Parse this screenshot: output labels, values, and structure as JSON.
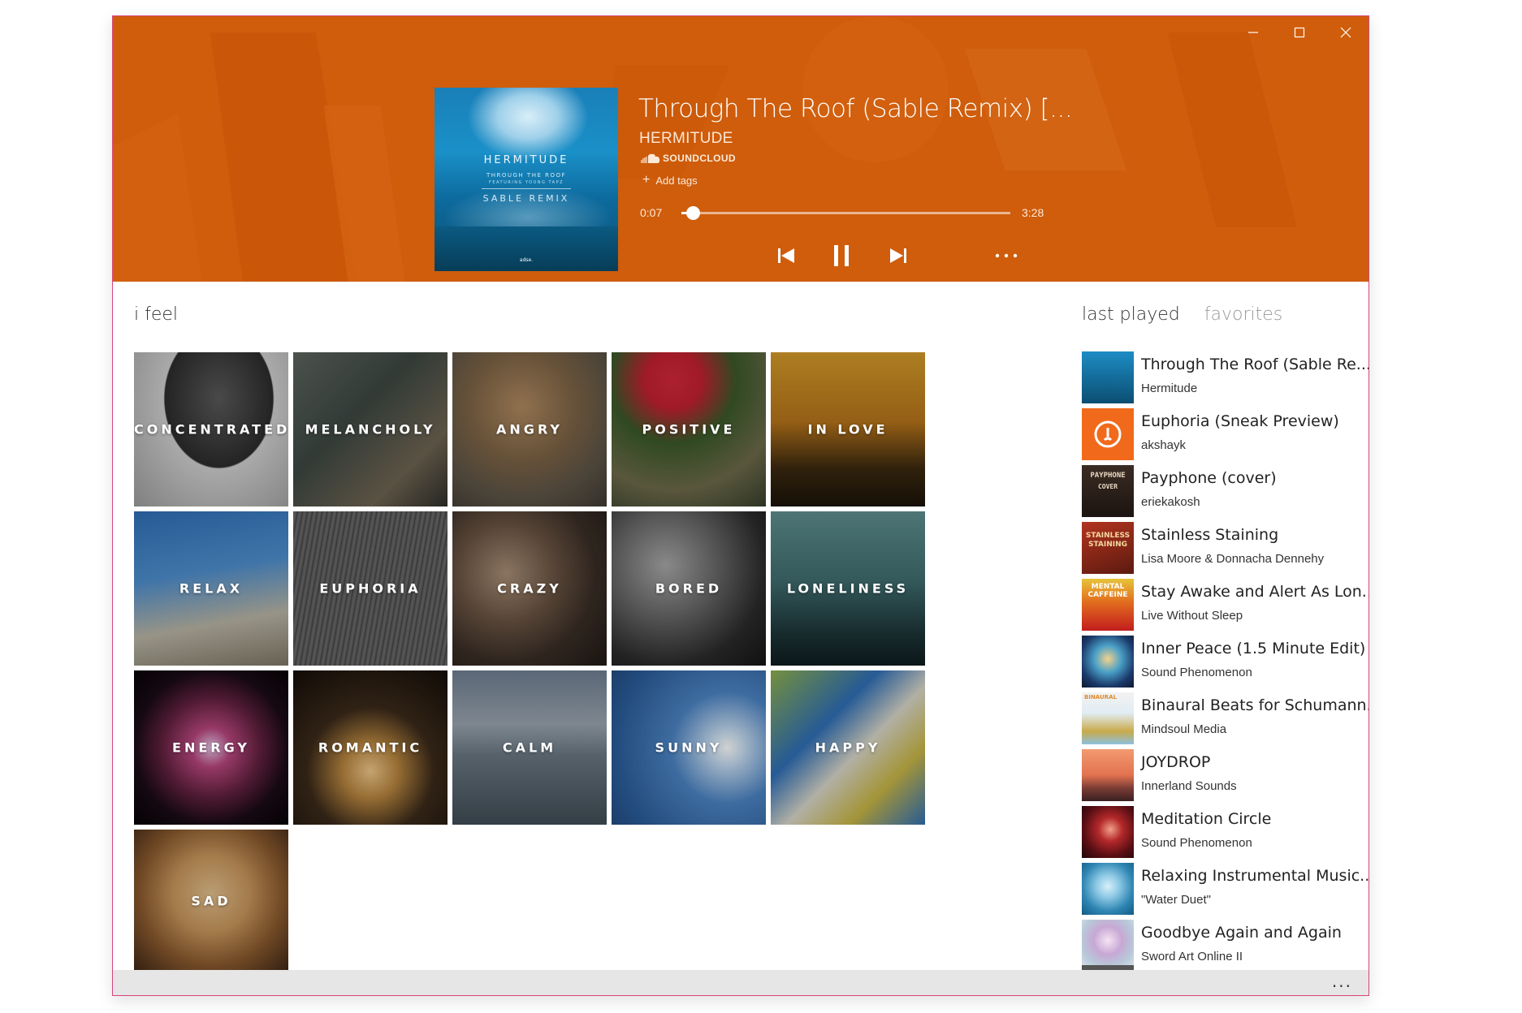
{
  "window": {
    "controls": [
      "minimize",
      "maximize",
      "close"
    ]
  },
  "now_playing": {
    "title": "Through The Roof (Sable Remix) [...",
    "artist": "HERMITUDE",
    "source": "SOUNDCLOUD",
    "add_tags_label": "Add tags",
    "time_current": "0:07",
    "time_total": "3:28",
    "progress_fraction": 0.034,
    "cover": {
      "line1": "HERMITUDE",
      "line2": "THROUGH THE ROOF",
      "line3": "FEATURING YOUNG TAPZ",
      "line4": "SABLE REMIX",
      "label": "adse."
    },
    "accent_color": "#cf5d0c"
  },
  "mood_section": {
    "title": "i feel",
    "tiles": [
      {
        "label": "CONCENTRATED"
      },
      {
        "label": "MELANCHOLY"
      },
      {
        "label": "ANGRY"
      },
      {
        "label": "POSITIVE"
      },
      {
        "label": "IN LOVE"
      },
      {
        "label": "RELAX"
      },
      {
        "label": "EUPHORIA"
      },
      {
        "label": "CRAZY"
      },
      {
        "label": "BORED"
      },
      {
        "label": "LONELINESS"
      },
      {
        "label": "ENERGY"
      },
      {
        "label": "ROMANTIC"
      },
      {
        "label": "CALM"
      },
      {
        "label": "SUNNY"
      },
      {
        "label": "HAPPY"
      },
      {
        "label": "SAD"
      }
    ]
  },
  "sidebar": {
    "tabs": [
      {
        "label": "last played"
      },
      {
        "label": "favorites"
      }
    ],
    "items": [
      {
        "title": "Through The Roof (Sable Re...",
        "artist": "Hermitude"
      },
      {
        "title": "Euphoria (Sneak Preview)",
        "artist": "akshayk"
      },
      {
        "title": "Payphone (cover)",
        "artist": "eriekakosh"
      },
      {
        "title": "Stainless Staining",
        "artist": "Lisa Moore & Donnacha Dennehy"
      },
      {
        "title": "Stay Awake and Alert As Lon...",
        "artist": "Live Without Sleep"
      },
      {
        "title": "Inner Peace (1.5 Minute Edit)",
        "artist": "Sound Phenomenon"
      },
      {
        "title": "Binaural Beats for Schumann...",
        "artist": "Mindsoul Media"
      },
      {
        "title": "JOYDROP",
        "artist": "Innerland Sounds"
      },
      {
        "title": "Meditation Circle",
        "artist": "Sound Phenomenon"
      },
      {
        "title": "Relaxing Instrumental Music...",
        "artist": "\"Water Duet\""
      },
      {
        "title": "Goodbye Again and Again",
        "artist": "Sword Art Online II"
      }
    ],
    "thumb_text": {
      "payphone": "PAYPHONE",
      "payphone_sub": "COVER",
      "stainless": "STAINLESS STAINING",
      "mental": "MENTAL CAFFEINE",
      "binaural": "BINAURAL"
    }
  },
  "bottom_bar": {
    "more_label": "..."
  }
}
